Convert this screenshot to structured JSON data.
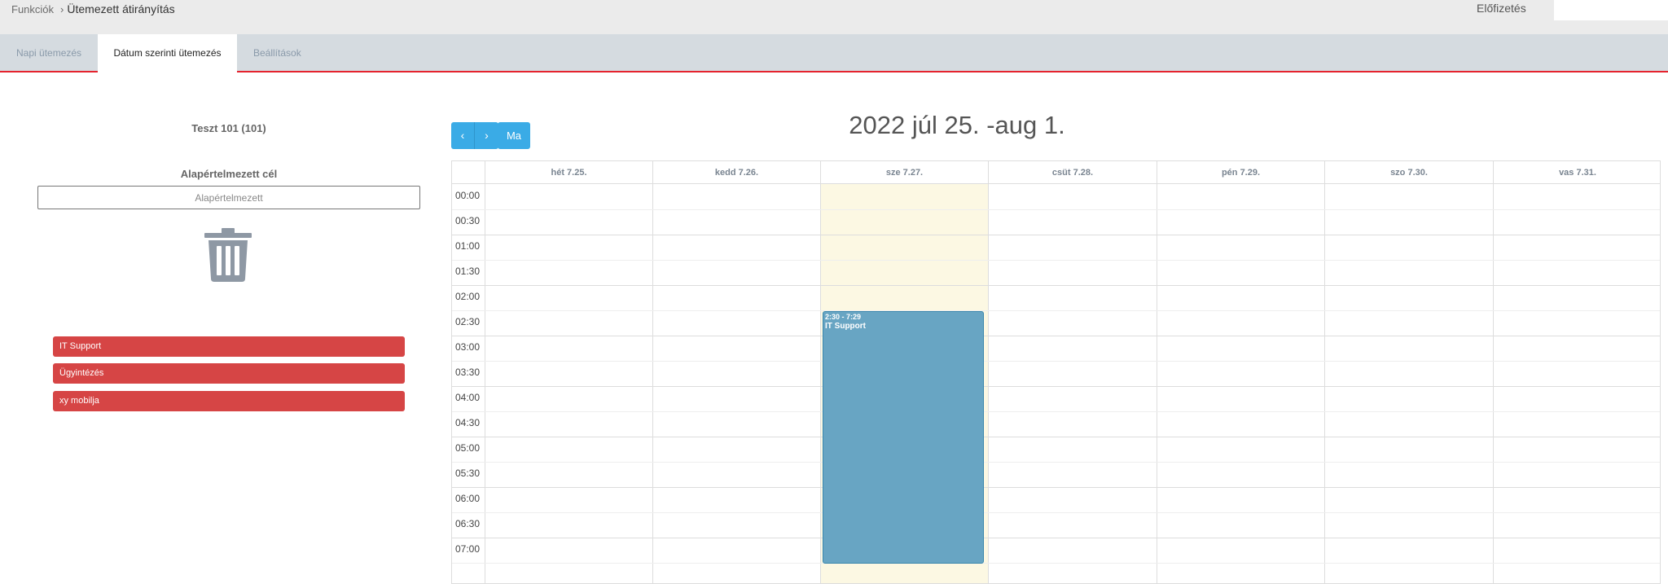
{
  "header": {
    "breadcrumb_root": "Funkciók",
    "breadcrumb_separator": "›",
    "breadcrumb_current": "Ütemezett átirányítás",
    "subscription_link": "Előfizetés"
  },
  "tabs": [
    {
      "label": "Napi ütemezés",
      "active": false
    },
    {
      "label": "Dátum szerinti ütemezés",
      "active": true
    },
    {
      "label": "Beállítások",
      "active": false
    }
  ],
  "left_panel": {
    "agent_name": "Teszt 101 (101)",
    "default_target_label": "Alapértelmezett cél",
    "default_target_placeholder": "Alapértelmezett",
    "delete_icon": "trash-icon",
    "targets": [
      "IT Support",
      "Ügyintézés",
      "xy mobilja"
    ]
  },
  "calendar": {
    "prev_label": "‹",
    "next_label": "›",
    "today_label": "Ma",
    "title": "2022 júl 25. -aug 1.",
    "days": [
      "hét 7.25.",
      "kedd 7.26.",
      "sze 7.27.",
      "csüt 7.28.",
      "pén 7.29.",
      "szo 7.30.",
      "vas 7.31."
    ],
    "today_index": 2,
    "times": [
      "00:00",
      "00:30",
      "01:00",
      "01:30",
      "02:00",
      "02:30",
      "03:00",
      "03:30",
      "04:00",
      "04:30",
      "05:00",
      "05:30",
      "06:00",
      "06:30",
      "07:00"
    ],
    "events": [
      {
        "day": "sze 7.27.",
        "time": "2:30 - 7:29",
        "title": "IT Support",
        "start": "02:30",
        "end": "07:29"
      }
    ]
  },
  "colors": {
    "accent_blue": "#3aabe6",
    "target_red": "#d64545",
    "event_blue": "#68a5c3",
    "today_highlight": "#fcf8e3",
    "tab_underline": "#e5232e"
  }
}
